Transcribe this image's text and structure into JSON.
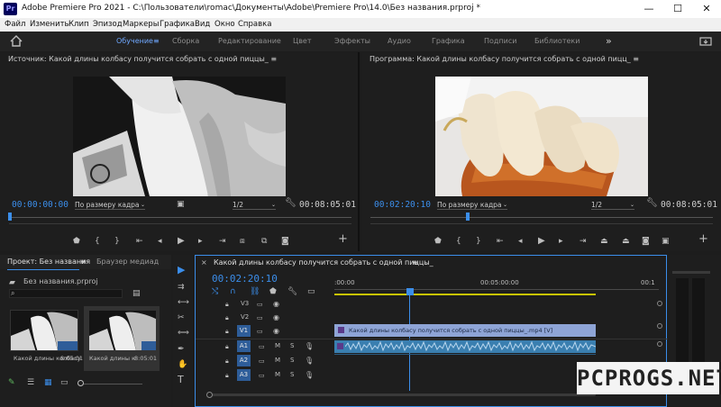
{
  "window": {
    "app_icon": "Pr",
    "title": "Adobe Premiere Pro 2021 - C:\\Пользователи\\romac\\Документы\\Adobe\\Premiere Pro\\14.0\\Без названия.prproj *",
    "minimize": "—",
    "maximize": "☐",
    "close": "✕"
  },
  "menu": [
    "Файл",
    "Изменить",
    "Клип",
    "Эпизод",
    "Маркеры",
    "Графика",
    "Вид",
    "Окно",
    "Справка"
  ],
  "workspaces": {
    "home_icon": "home-icon",
    "items": [
      "Обучение",
      "Сборка",
      "Редактирование",
      "Цвет",
      "Эффекты",
      "Аудио",
      "Графика",
      "Подписи",
      "Библиотеки"
    ],
    "active": "Обучение",
    "more": "»"
  },
  "source_monitor": {
    "title": "Источник: Какой длины колбасу получится собрать с одной пиццы_",
    "menu_icon": "≡",
    "timecode_in": "00:00:00:00",
    "fit": "По размеру кадра",
    "resolution": "1/2",
    "duration": "00:08:05:01"
  },
  "program_monitor": {
    "title": "Программа: Какой длины колбасу получится собрать с одной пицц_",
    "menu_icon": "≡",
    "timecode_in": "00:02:20:10",
    "fit": "По размеру кадра",
    "resolution": "1/2",
    "duration": "00:08:05:01"
  },
  "project": {
    "tab_project": "Проект: Без названия",
    "tab_browser": "Браузер медиад",
    "menu_icon": "≡",
    "file": "Без названия.prproj",
    "items": [
      {
        "name": "Какой длины колбасу",
        "duration": "8:05:01"
      },
      {
        "name": "Какой длины к",
        "duration": "8:05:01"
      }
    ]
  },
  "timeline": {
    "tab": "Какой длины колбасу получится собрать с одной пиццы_",
    "menu_icon": "≡",
    "close_icon": "×",
    "timecode": "00:02:20:10",
    "ruler": [
      ":00:00",
      "00:05:00:00",
      "00:1"
    ],
    "video_tracks": [
      "V3",
      "V2",
      "V1"
    ],
    "audio_tracks": [
      "A1",
      "A2",
      "A3"
    ],
    "source_patch_v": "V1",
    "source_patch_a": [
      "A1",
      "A2",
      "A3"
    ],
    "mute": "M",
    "solo": "S",
    "clip_video": "Какой длины колбасу получится собрать с одной пиццы_.mp4 [V]"
  },
  "watermark": "PCPROGS.NET",
  "colors": {
    "accent_blue": "#3b8eea",
    "clip_video": "#8ea4d6",
    "clip_audio": "#3a7fb0",
    "playhead": "#4a90e2"
  }
}
